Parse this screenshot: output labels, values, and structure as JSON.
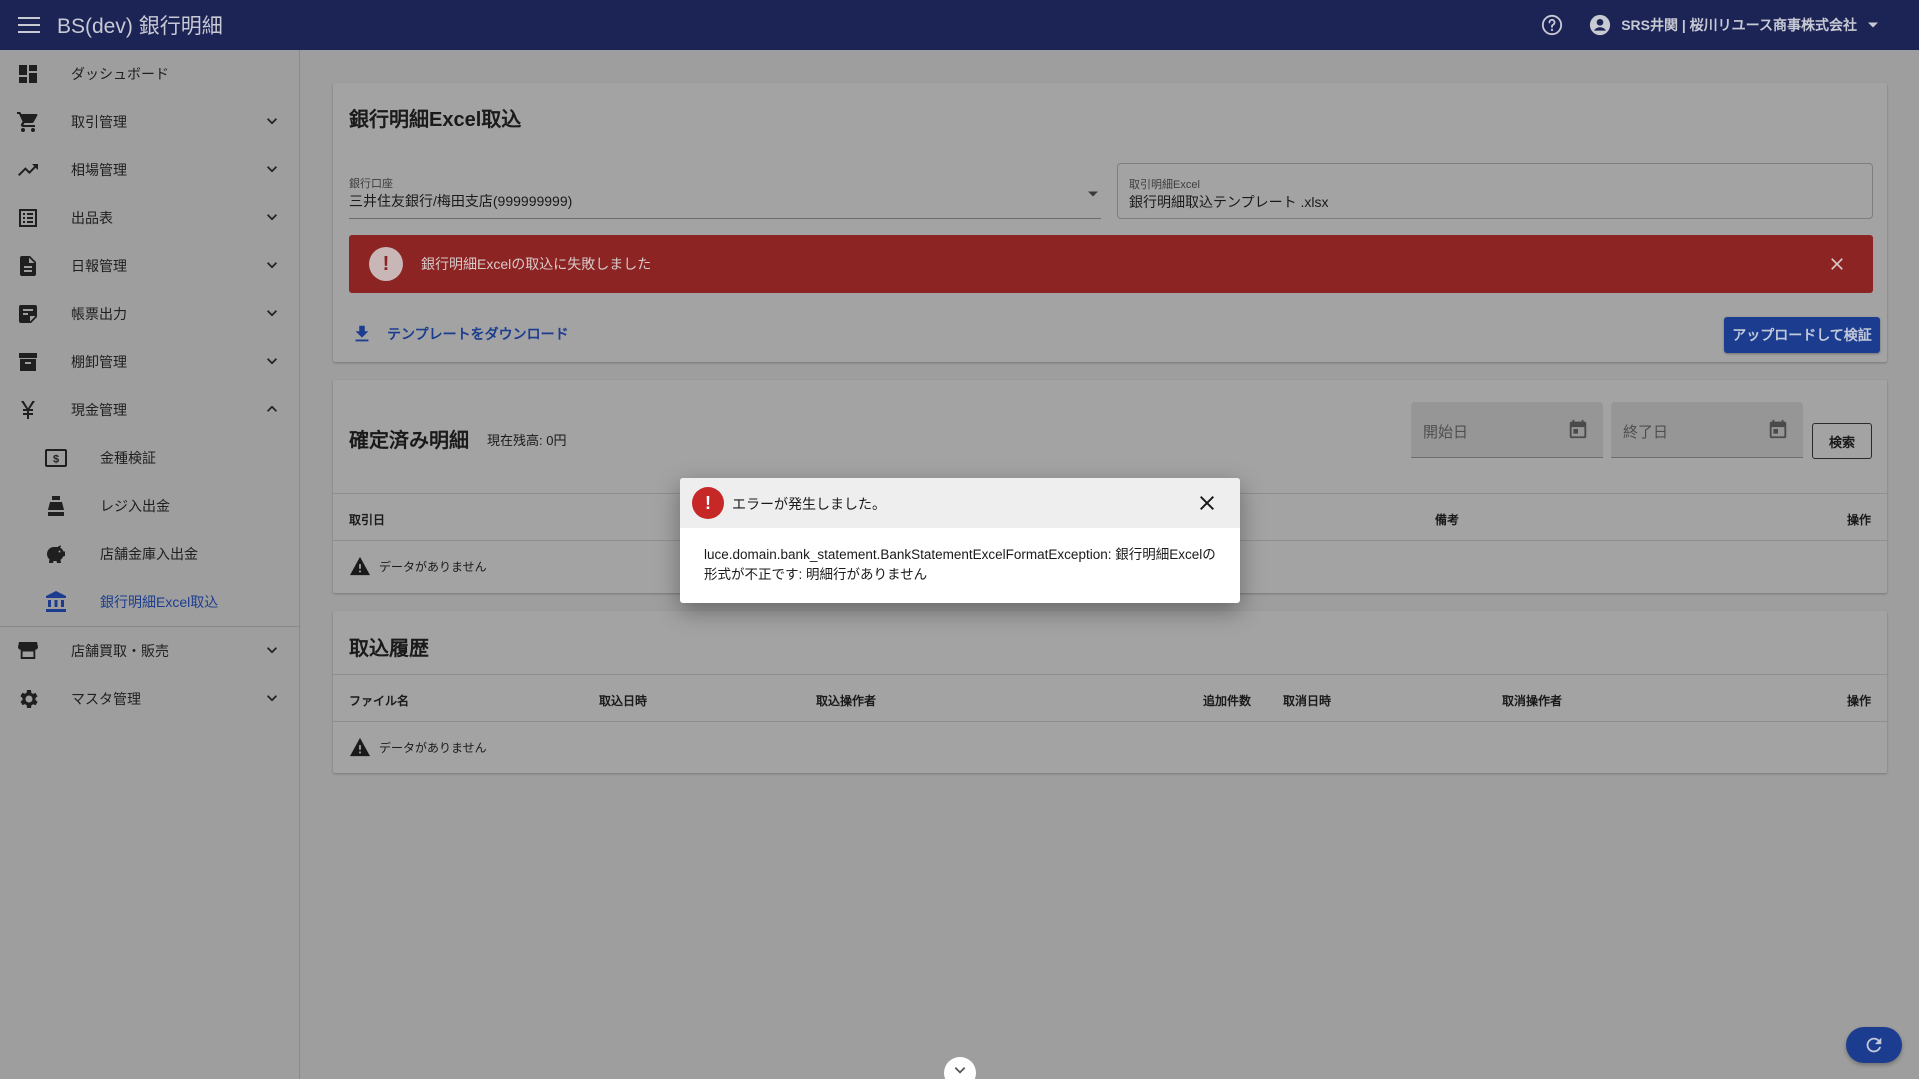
{
  "app": {
    "title": "BS(dev) 銀行明細",
    "user": "SRS井関 | 桜川リユース商事株式会社"
  },
  "sidebar": {
    "items": [
      {
        "label": "ダッシュボード"
      },
      {
        "label": "取引管理"
      },
      {
        "label": "相場管理"
      },
      {
        "label": "出品表"
      },
      {
        "label": "日報管理"
      },
      {
        "label": "帳票出力"
      },
      {
        "label": "棚卸管理"
      },
      {
        "label": "現金管理"
      }
    ],
    "sub_items": [
      {
        "label": "金種検証"
      },
      {
        "label": "レジ入出金"
      },
      {
        "label": "店舗金庫入出金"
      },
      {
        "label": "銀行明細Excel取込"
      }
    ],
    "bottom_items": [
      {
        "label": "店舗買取・販売"
      },
      {
        "label": "マスタ管理"
      }
    ]
  },
  "import_card": {
    "title": "銀行明細Excel取込",
    "bank_account": {
      "label": "銀行口座",
      "value": "三井住友銀行/梅田支店(999999999)"
    },
    "excel_file": {
      "label": "取引明細Excel",
      "value": "銀行明細取込テンプレート .xlsx"
    },
    "alert_text": "銀行明細Excelの取込に失敗しました",
    "download_link": "テンプレートをダウンロード",
    "upload_button": "アップロードして検証"
  },
  "confirmed_card": {
    "title": "確定済み明細",
    "balance": "現在残高: 0円",
    "start_date_placeholder": "開始日",
    "end_date_placeholder": "終了日",
    "search_button": "検索",
    "columns": [
      "取引日",
      "備考",
      "操作"
    ],
    "empty_text": "データがありません"
  },
  "history_card": {
    "title": "取込履歴",
    "columns": [
      "ファイル名",
      "取込日時",
      "取込操作者",
      "追加件数",
      "取消日時",
      "取消操作者",
      "操作"
    ],
    "empty_text": "データがありません"
  },
  "dialog": {
    "title": "エラーが発生しました。",
    "message": "luce.domain.bank_statement.BankStatementExcelFormatException: 銀行明細Excelの形式が不正です: 明細行がありません"
  },
  "colors": {
    "appbar": "#1c2456",
    "accent": "#1c3d8f",
    "error": "#c62828",
    "alert_bg": "#8c2424"
  }
}
